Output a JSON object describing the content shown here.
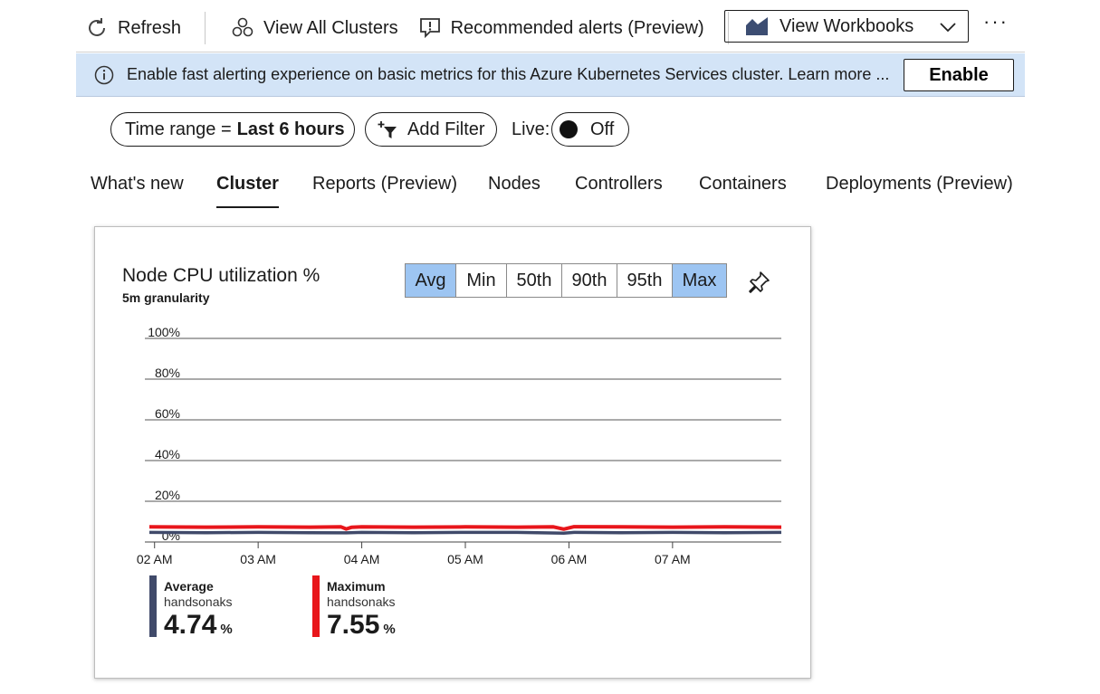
{
  "toolbar": {
    "refresh_label": "Refresh",
    "view_clusters_label": "View All Clusters",
    "recommended_alerts_label": "Recommended alerts (Preview)",
    "workbooks_label": "View Workbooks",
    "more_label": "···"
  },
  "banner": {
    "text": "Enable fast alerting experience on basic metrics for this Azure Kubernetes Services cluster. Learn more ...",
    "enable_label": "Enable"
  },
  "filters": {
    "time_range_prefix": "Time range =",
    "time_range_value": "Last 6 hours",
    "add_filter_label": "Add Filter",
    "live_label": "Live:",
    "live_state": "Off"
  },
  "tabs": [
    {
      "label": "What's new"
    },
    {
      "label": "Cluster"
    },
    {
      "label": "Reports (Preview)"
    },
    {
      "label": "Nodes"
    },
    {
      "label": "Controllers"
    },
    {
      "label": "Containers"
    },
    {
      "label": "Deployments (Preview)"
    }
  ],
  "active_tab": "Cluster",
  "card": {
    "title": "Node CPU utilization %",
    "subtitle": "5m granularity",
    "aggregations": [
      {
        "label": "Avg",
        "selected": true
      },
      {
        "label": "Min",
        "selected": false
      },
      {
        "label": "50th",
        "selected": false
      },
      {
        "label": "90th",
        "selected": false
      },
      {
        "label": "95th",
        "selected": false
      },
      {
        "label": "Max",
        "selected": true
      }
    ],
    "legend": [
      {
        "name": "Average",
        "source": "handsonaks",
        "value": "4.74",
        "unit": "%",
        "color": "#404a6a"
      },
      {
        "name": "Maximum",
        "source": "handsonaks",
        "value": "7.55",
        "unit": "%",
        "color": "#e8161b"
      }
    ]
  },
  "chart_data": {
    "type": "line",
    "title": "Node CPU utilization %",
    "y_ticks": [
      "100%",
      "80%",
      "60%",
      "40%",
      "20%",
      "0%"
    ],
    "ylim": [
      0,
      100
    ],
    "x_ticks": [
      "02 AM",
      "03 AM",
      "04 AM",
      "05 AM",
      "06 AM",
      "07 AM"
    ],
    "x_start_hours": 1.95,
    "x_end_hours": 8.05,
    "series": [
      {
        "name": "Maximum",
        "color": "#e8161b",
        "x": [
          1.95,
          2.5,
          3.0,
          3.5,
          3.8,
          3.85,
          3.9,
          4.0,
          4.5,
          5.0,
          5.5,
          5.85,
          5.95,
          6.05,
          6.5,
          7.0,
          7.5,
          8.05
        ],
        "values": [
          7.4,
          7.3,
          7.4,
          7.3,
          7.4,
          6.4,
          7.2,
          7.4,
          7.3,
          7.4,
          7.3,
          7.4,
          6.3,
          7.5,
          7.4,
          7.3,
          7.4,
          7.3
        ]
      },
      {
        "name": "Average",
        "color": "#404a6a",
        "x": [
          1.95,
          2.5,
          3.0,
          3.5,
          3.85,
          4.0,
          4.5,
          5.0,
          5.5,
          5.95,
          6.05,
          6.5,
          7.0,
          7.5,
          8.05
        ],
        "values": [
          4.7,
          4.6,
          4.7,
          4.6,
          4.5,
          4.7,
          4.6,
          4.7,
          4.7,
          4.3,
          4.7,
          4.6,
          4.7,
          4.6,
          4.7
        ]
      }
    ]
  }
}
